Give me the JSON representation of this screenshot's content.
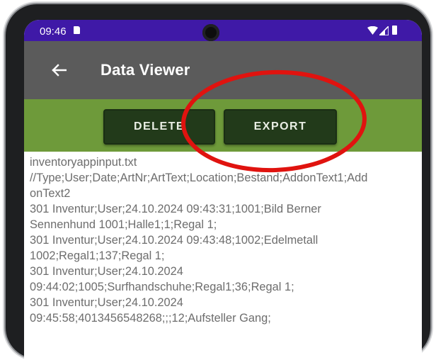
{
  "status_bar": {
    "time": "09:46",
    "icons": [
      "sd-card-icon",
      "wifi-icon",
      "signal-icon",
      "battery-icon"
    ]
  },
  "app_bar": {
    "back_icon": "arrow-left-icon",
    "title": "Data Viewer",
    "color": "#5b5b5b"
  },
  "toolbar": {
    "delete_label": "DELETE",
    "export_label": "EXPORT",
    "color": "#6e9a3a",
    "button_color": "#223a1a"
  },
  "content": {
    "lines": [
      "inventoryappinput.txt",
      "//Type;User;Date;ArtNr;ArtText;Location;Bestand;AddonText1;Add",
      "onText2",
      "301 Inventur;User;24.10.2024 09:43:31;1001;Bild Berner",
      "Sennenhund 1001;Halle1;1;Regal 1;",
      "301 Inventur;User;24.10.2024 09:43:48;1002;Edelmetall",
      "1002;Regal1;137;Regal 1;",
      "301 Inventur;User;24.10.2024",
      "09:44:02;1005;Surfhandschuhe;Regal1;36;Regal 1;",
      "301 Inventur;User;24.10.2024",
      "09:45:58;4013456548268;;;12;Aufsteller Gang;"
    ]
  },
  "annotation": {
    "shape": "ellipse",
    "color": "#e0130f"
  }
}
